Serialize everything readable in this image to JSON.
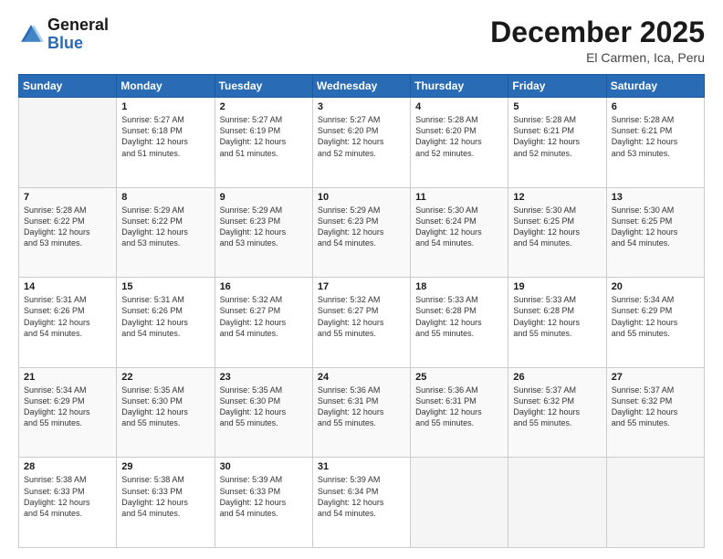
{
  "header": {
    "logo_general": "General",
    "logo_blue": "Blue",
    "month_title": "December 2025",
    "location": "El Carmen, Ica, Peru"
  },
  "days_of_week": [
    "Sunday",
    "Monday",
    "Tuesday",
    "Wednesday",
    "Thursday",
    "Friday",
    "Saturday"
  ],
  "weeks": [
    [
      {
        "day": "",
        "info": ""
      },
      {
        "day": "1",
        "info": "Sunrise: 5:27 AM\nSunset: 6:18 PM\nDaylight: 12 hours\nand 51 minutes."
      },
      {
        "day": "2",
        "info": "Sunrise: 5:27 AM\nSunset: 6:19 PM\nDaylight: 12 hours\nand 51 minutes."
      },
      {
        "day": "3",
        "info": "Sunrise: 5:27 AM\nSunset: 6:20 PM\nDaylight: 12 hours\nand 52 minutes."
      },
      {
        "day": "4",
        "info": "Sunrise: 5:28 AM\nSunset: 6:20 PM\nDaylight: 12 hours\nand 52 minutes."
      },
      {
        "day": "5",
        "info": "Sunrise: 5:28 AM\nSunset: 6:21 PM\nDaylight: 12 hours\nand 52 minutes."
      },
      {
        "day": "6",
        "info": "Sunrise: 5:28 AM\nSunset: 6:21 PM\nDaylight: 12 hours\nand 53 minutes."
      }
    ],
    [
      {
        "day": "7",
        "info": "Sunrise: 5:28 AM\nSunset: 6:22 PM\nDaylight: 12 hours\nand 53 minutes."
      },
      {
        "day": "8",
        "info": "Sunrise: 5:29 AM\nSunset: 6:22 PM\nDaylight: 12 hours\nand 53 minutes."
      },
      {
        "day": "9",
        "info": "Sunrise: 5:29 AM\nSunset: 6:23 PM\nDaylight: 12 hours\nand 53 minutes."
      },
      {
        "day": "10",
        "info": "Sunrise: 5:29 AM\nSunset: 6:23 PM\nDaylight: 12 hours\nand 54 minutes."
      },
      {
        "day": "11",
        "info": "Sunrise: 5:30 AM\nSunset: 6:24 PM\nDaylight: 12 hours\nand 54 minutes."
      },
      {
        "day": "12",
        "info": "Sunrise: 5:30 AM\nSunset: 6:25 PM\nDaylight: 12 hours\nand 54 minutes."
      },
      {
        "day": "13",
        "info": "Sunrise: 5:30 AM\nSunset: 6:25 PM\nDaylight: 12 hours\nand 54 minutes."
      }
    ],
    [
      {
        "day": "14",
        "info": "Sunrise: 5:31 AM\nSunset: 6:26 PM\nDaylight: 12 hours\nand 54 minutes."
      },
      {
        "day": "15",
        "info": "Sunrise: 5:31 AM\nSunset: 6:26 PM\nDaylight: 12 hours\nand 54 minutes."
      },
      {
        "day": "16",
        "info": "Sunrise: 5:32 AM\nSunset: 6:27 PM\nDaylight: 12 hours\nand 54 minutes."
      },
      {
        "day": "17",
        "info": "Sunrise: 5:32 AM\nSunset: 6:27 PM\nDaylight: 12 hours\nand 55 minutes."
      },
      {
        "day": "18",
        "info": "Sunrise: 5:33 AM\nSunset: 6:28 PM\nDaylight: 12 hours\nand 55 minutes."
      },
      {
        "day": "19",
        "info": "Sunrise: 5:33 AM\nSunset: 6:28 PM\nDaylight: 12 hours\nand 55 minutes."
      },
      {
        "day": "20",
        "info": "Sunrise: 5:34 AM\nSunset: 6:29 PM\nDaylight: 12 hours\nand 55 minutes."
      }
    ],
    [
      {
        "day": "21",
        "info": "Sunrise: 5:34 AM\nSunset: 6:29 PM\nDaylight: 12 hours\nand 55 minutes."
      },
      {
        "day": "22",
        "info": "Sunrise: 5:35 AM\nSunset: 6:30 PM\nDaylight: 12 hours\nand 55 minutes."
      },
      {
        "day": "23",
        "info": "Sunrise: 5:35 AM\nSunset: 6:30 PM\nDaylight: 12 hours\nand 55 minutes."
      },
      {
        "day": "24",
        "info": "Sunrise: 5:36 AM\nSunset: 6:31 PM\nDaylight: 12 hours\nand 55 minutes."
      },
      {
        "day": "25",
        "info": "Sunrise: 5:36 AM\nSunset: 6:31 PM\nDaylight: 12 hours\nand 55 minutes."
      },
      {
        "day": "26",
        "info": "Sunrise: 5:37 AM\nSunset: 6:32 PM\nDaylight: 12 hours\nand 55 minutes."
      },
      {
        "day": "27",
        "info": "Sunrise: 5:37 AM\nSunset: 6:32 PM\nDaylight: 12 hours\nand 55 minutes."
      }
    ],
    [
      {
        "day": "28",
        "info": "Sunrise: 5:38 AM\nSunset: 6:33 PM\nDaylight: 12 hours\nand 54 minutes."
      },
      {
        "day": "29",
        "info": "Sunrise: 5:38 AM\nSunset: 6:33 PM\nDaylight: 12 hours\nand 54 minutes."
      },
      {
        "day": "30",
        "info": "Sunrise: 5:39 AM\nSunset: 6:33 PM\nDaylight: 12 hours\nand 54 minutes."
      },
      {
        "day": "31",
        "info": "Sunrise: 5:39 AM\nSunset: 6:34 PM\nDaylight: 12 hours\nand 54 minutes."
      },
      {
        "day": "",
        "info": ""
      },
      {
        "day": "",
        "info": ""
      },
      {
        "day": "",
        "info": ""
      }
    ]
  ]
}
